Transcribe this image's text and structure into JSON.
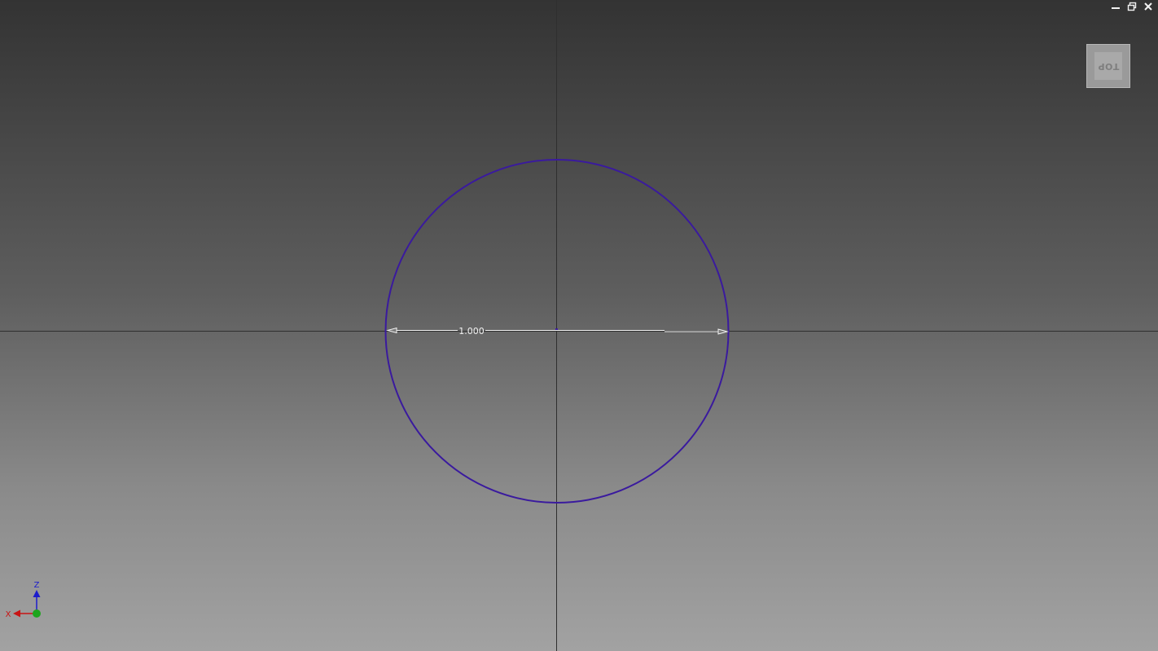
{
  "viewcube": {
    "face_label": "TOP"
  },
  "sketch": {
    "dimension_value": "1.000",
    "circle_color": "#3a1a9e",
    "dimension_color": "#f4f4f4",
    "axis_line_color": "#2f2f2f"
  },
  "triad": {
    "x_label": "X",
    "z_label": "Z",
    "x_color": "#c81414",
    "y_color": "#1ea51e",
    "z_color": "#1d1dcc"
  },
  "icons": {
    "minimize": "minimize-icon",
    "restore": "restore-icon",
    "close": "close-icon"
  }
}
